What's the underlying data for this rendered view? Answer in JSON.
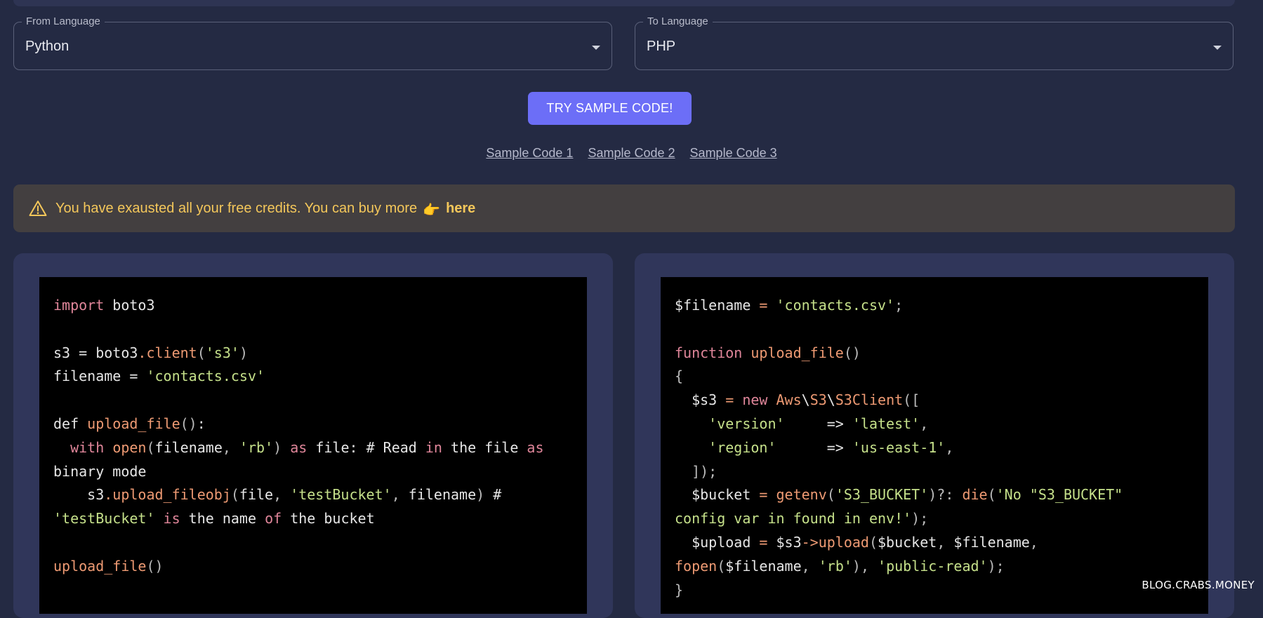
{
  "from_select": {
    "legend": "From Language",
    "value": "Python"
  },
  "to_select": {
    "legend": "To Language",
    "value": "PHP"
  },
  "try_button": {
    "label": "TRY SAMPLE CODE!"
  },
  "sample_links": [
    "Sample Code 1",
    "Sample Code 2",
    "Sample Code 3"
  ],
  "alert": {
    "message": "You have exausted all your free credits. You can buy more",
    "icon": "warning-triangle-icon",
    "point_icon": "pointing-hand-icon",
    "point_glyph": "👉",
    "link_label": "here"
  },
  "colors": {
    "background": "#242a43",
    "panel": "#30365a",
    "button": "#6c6ef7",
    "alert_bg": "#433f40",
    "alert_text": "#f4c75a",
    "keyword": "#e0869a",
    "function": "#ee9a73",
    "string": "#c5e08a"
  },
  "input_code": [
    [
      [
        "kw",
        "import"
      ],
      [
        "pl",
        " boto3"
      ]
    ],
    [],
    [
      [
        "pl",
        "s3 = boto3"
      ],
      [
        "fn",
        ".client"
      ],
      [
        "pn",
        "("
      ],
      [
        "str",
        "'s3'"
      ],
      [
        "pn",
        ")"
      ]
    ],
    [
      [
        "pl",
        "filename = "
      ],
      [
        "str",
        "'contacts.csv'"
      ]
    ],
    [],
    [
      [
        "pl",
        "def "
      ],
      [
        "fn",
        "upload_file"
      ],
      [
        "pn",
        "()"
      ],
      [
        "pl",
        ":"
      ]
    ],
    [
      [
        "pl",
        "  "
      ],
      [
        "kw",
        "with"
      ],
      [
        "pl",
        " "
      ],
      [
        "fn",
        "open"
      ],
      [
        "pn",
        "("
      ],
      [
        "pl",
        "filename"
      ],
      [
        "pn",
        ", "
      ],
      [
        "str",
        "'rb'"
      ],
      [
        "pn",
        ")"
      ],
      [
        "pl",
        " "
      ],
      [
        "kw",
        "as"
      ],
      [
        "pl",
        " file: # Read "
      ],
      [
        "kw",
        "in"
      ],
      [
        "pl",
        " the file "
      ],
      [
        "kw",
        "as"
      ]
    ],
    [
      [
        "pl",
        "binary mode"
      ]
    ],
    [
      [
        "pl",
        "    s3"
      ],
      [
        "fn",
        ".upload_fileobj"
      ],
      [
        "pn",
        "("
      ],
      [
        "pl",
        "file"
      ],
      [
        "pn",
        ", "
      ],
      [
        "str",
        "'testBucket'"
      ],
      [
        "pn",
        ", "
      ],
      [
        "pl",
        "filename"
      ],
      [
        "pn",
        ")"
      ],
      [
        "pl",
        " #"
      ]
    ],
    [
      [
        "str",
        "'testBucket'"
      ],
      [
        "pl",
        " "
      ],
      [
        "kw",
        "is"
      ],
      [
        "pl",
        " the name "
      ],
      [
        "kw",
        "of"
      ],
      [
        "pl",
        " the bucket"
      ]
    ],
    [],
    [
      [
        "fn",
        "upload_file"
      ],
      [
        "pn",
        "()"
      ]
    ]
  ],
  "output_code": [
    [
      [
        "pl",
        "$filename "
      ],
      [
        "fn",
        "="
      ],
      [
        "pl",
        " "
      ],
      [
        "str",
        "'contacts.csv'"
      ],
      [
        "pn",
        ";"
      ]
    ],
    [],
    [
      [
        "kw",
        "function"
      ],
      [
        "pl",
        " "
      ],
      [
        "fn",
        "upload_file"
      ],
      [
        "pn",
        "()"
      ]
    ],
    [
      [
        "pn",
        "{"
      ]
    ],
    [
      [
        "pl",
        "  $s3 "
      ],
      [
        "fn",
        "="
      ],
      [
        "pl",
        " "
      ],
      [
        "kw",
        "new"
      ],
      [
        "pl",
        " "
      ],
      [
        "fn",
        "Aws"
      ],
      [
        "pl",
        "\\"
      ],
      [
        "fn",
        "S3"
      ],
      [
        "pl",
        "\\"
      ],
      [
        "fn",
        "S3Client"
      ],
      [
        "pn",
        "(["
      ]
    ],
    [
      [
        "pl",
        "    "
      ],
      [
        "str",
        "'version'"
      ],
      [
        "pl",
        "     => "
      ],
      [
        "str",
        "'latest'"
      ],
      [
        "pn",
        ","
      ]
    ],
    [
      [
        "pl",
        "    "
      ],
      [
        "str",
        "'region'"
      ],
      [
        "pl",
        "      => "
      ],
      [
        "str",
        "'us-east-1'"
      ],
      [
        "pn",
        ","
      ]
    ],
    [
      [
        "pn",
        "  ]);"
      ]
    ],
    [
      [
        "pl",
        "  $bucket "
      ],
      [
        "fn",
        "="
      ],
      [
        "pl",
        " "
      ],
      [
        "fn",
        "getenv"
      ],
      [
        "pn",
        "("
      ],
      [
        "str",
        "'S3_BUCKET'"
      ],
      [
        "pn",
        ")?: "
      ],
      [
        "fn",
        "die"
      ],
      [
        "pn",
        "("
      ],
      [
        "str",
        "'No \"S3_BUCKET\""
      ]
    ],
    [
      [
        "str",
        "config var in found in env!'"
      ],
      [
        "pn",
        ");"
      ]
    ],
    [
      [
        "pl",
        "  $upload "
      ],
      [
        "fn",
        "="
      ],
      [
        "pl",
        " $s3"
      ],
      [
        "fn",
        "->upload"
      ],
      [
        "pn",
        "("
      ],
      [
        "pl",
        "$bucket"
      ],
      [
        "pn",
        ", "
      ],
      [
        "pl",
        "$filename"
      ],
      [
        "pn",
        ","
      ]
    ],
    [
      [
        "fn",
        "fopen"
      ],
      [
        "pn",
        "("
      ],
      [
        "pl",
        "$filename"
      ],
      [
        "pn",
        ", "
      ],
      [
        "str",
        "'rb'"
      ],
      [
        "pn",
        "), "
      ],
      [
        "str",
        "'public-read'"
      ],
      [
        "pn",
        ");"
      ]
    ],
    [
      [
        "pn",
        "}"
      ]
    ]
  ],
  "watermark": "BLOG.CRABS.MONEY"
}
